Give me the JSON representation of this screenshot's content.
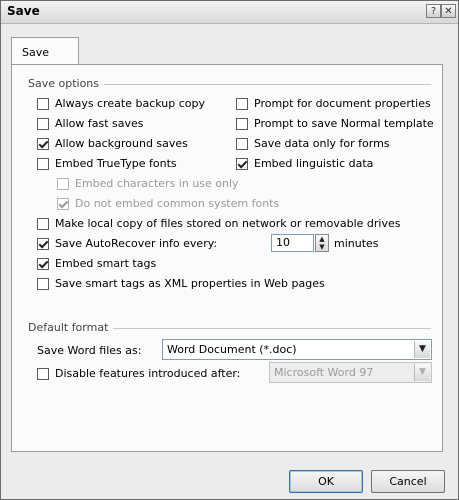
{
  "window": {
    "title": "Save",
    "help_glyph": "?",
    "close_glyph": "✕"
  },
  "tabs": [
    {
      "label": "Save"
    }
  ],
  "save_options": {
    "heading": "Save options",
    "left_column": [
      {
        "label": "Always create backup copy",
        "checked": false
      },
      {
        "label": "Allow fast saves",
        "checked": false
      },
      {
        "label": "Allow background saves",
        "checked": true
      },
      {
        "label": "Embed TrueType fonts",
        "checked": false
      }
    ],
    "right_column": [
      {
        "label": "Prompt for document properties",
        "checked": false
      },
      {
        "label": "Prompt to save Normal template",
        "checked": false
      },
      {
        "label": "Save data only for forms",
        "checked": false
      },
      {
        "label": "Embed linguistic data",
        "checked": true
      }
    ],
    "font_sub_options": [
      {
        "label": "Embed characters in use only",
        "checked": false,
        "disabled": true
      },
      {
        "label": "Do not embed common system fonts",
        "checked": true,
        "disabled": true
      }
    ],
    "full_width": [
      {
        "label": "Make local copy of files stored on network or removable drives",
        "checked": false
      },
      {
        "label": "Save AutoRecover info every:",
        "checked": true
      },
      {
        "label": "Embed smart tags",
        "checked": true
      },
      {
        "label": "Save smart tags as XML properties in Web pages",
        "checked": false
      }
    ],
    "autorecover": {
      "value": "10",
      "unit": "minutes"
    }
  },
  "default_format": {
    "heading": "Default format",
    "save_as_label": "Save Word files as:",
    "save_as_value": "Word Document (*.doc)",
    "disable_features_label": "Disable features introduced after:",
    "disable_features_checked": false,
    "disable_features_value": "Microsoft Word 97"
  },
  "buttons": {
    "ok": "OK",
    "cancel": "Cancel"
  },
  "icons": {
    "dropdown": "chevron-down-icon",
    "spinner": "spinner-updown-icon"
  }
}
